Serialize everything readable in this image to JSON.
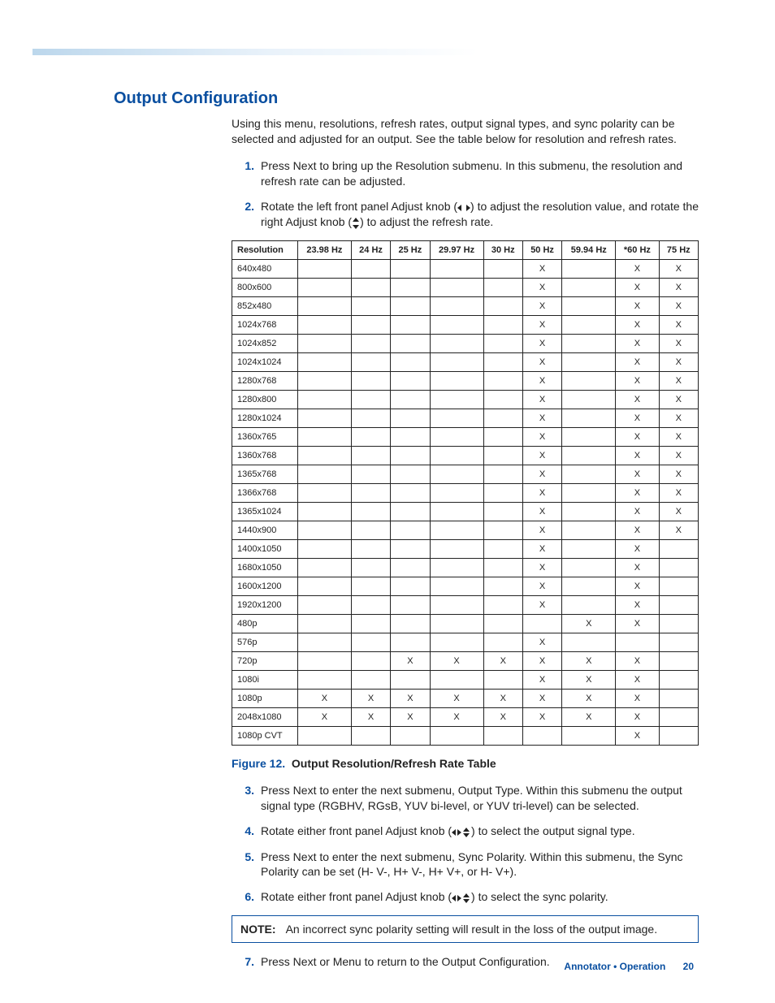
{
  "heading": "Output Configuration",
  "intro": "Using this menu, resolutions, refresh rates, output signal types, and sync polarity can be selected and adjusted for an output. See the table below for resolution and refresh rates.",
  "steps": [
    {
      "n": "1.",
      "text": "Press Next to bring up the Resolution submenu. In this submenu, the resolution and refresh rate can be adjusted."
    },
    {
      "n": "2.",
      "text_before": "Rotate the left front panel Adjust knob (",
      "text_mid": ") to adjust the resolution value, and rotate the right Adjust knob (",
      "text_after": ") to adjust the refresh rate.",
      "icon1": "lr",
      "icon2": "ud"
    },
    {
      "n": "3.",
      "text": "Press Next to enter the next submenu, Output Type. Within this submenu the output signal type (RGBHV, RGsB, YUV bi-level, or YUV tri-level) can be selected."
    },
    {
      "n": "4.",
      "text_before": "Rotate either front panel Adjust knob (",
      "text_after": ") to select the output signal type.",
      "icon1": "lrud"
    },
    {
      "n": "5.",
      "text": "Press Next to enter the next submenu, Sync Polarity. Within this submenu, the Sync Polarity can be set (H- V-, H+ V-, H+ V+, or H- V+)."
    },
    {
      "n": "6.",
      "text_before": "Rotate either front panel Adjust knob (",
      "text_after": ") to select the sync polarity.",
      "icon1": "lrud"
    },
    {
      "n": "7.",
      "text": "Press Next or Menu to return to the Output Configuration."
    }
  ],
  "note": {
    "label": "NOTE:",
    "body": "An incorrect sync polarity setting will result in the loss of the output image."
  },
  "figure": {
    "label": "Figure 12.",
    "title": "Output Resolution/Refresh Rate Table"
  },
  "table": {
    "headers": [
      "Resolution",
      "23.98 Hz",
      "24 Hz",
      "25 Hz",
      "29.97 Hz",
      "30 Hz",
      "50 Hz",
      "59.94 Hz",
      "*60 Hz",
      "75 Hz"
    ],
    "rows": [
      [
        "640x480",
        "",
        "",
        "",
        "",
        "",
        "X",
        "",
        "X",
        "X"
      ],
      [
        "800x600",
        "",
        "",
        "",
        "",
        "",
        "X",
        "",
        "X",
        "X"
      ],
      [
        "852x480",
        "",
        "",
        "",
        "",
        "",
        "X",
        "",
        "X",
        "X"
      ],
      [
        "1024x768",
        "",
        "",
        "",
        "",
        "",
        "X",
        "",
        "X",
        "X"
      ],
      [
        "1024x852",
        "",
        "",
        "",
        "",
        "",
        "X",
        "",
        "X",
        "X"
      ],
      [
        "1024x1024",
        "",
        "",
        "",
        "",
        "",
        "X",
        "",
        "X",
        "X"
      ],
      [
        "1280x768",
        "",
        "",
        "",
        "",
        "",
        "X",
        "",
        "X",
        "X"
      ],
      [
        "1280x800",
        "",
        "",
        "",
        "",
        "",
        "X",
        "",
        "X",
        "X"
      ],
      [
        "1280x1024",
        "",
        "",
        "",
        "",
        "",
        "X",
        "",
        "X",
        "X"
      ],
      [
        "1360x765",
        "",
        "",
        "",
        "",
        "",
        "X",
        "",
        "X",
        "X"
      ],
      [
        "1360x768",
        "",
        "",
        "",
        "",
        "",
        "X",
        "",
        "X",
        "X"
      ],
      [
        "1365x768",
        "",
        "",
        "",
        "",
        "",
        "X",
        "",
        "X",
        "X"
      ],
      [
        "1366x768",
        "",
        "",
        "",
        "",
        "",
        "X",
        "",
        "X",
        "X"
      ],
      [
        "1365x1024",
        "",
        "",
        "",
        "",
        "",
        "X",
        "",
        "X",
        "X"
      ],
      [
        "1440x900",
        "",
        "",
        "",
        "",
        "",
        "X",
        "",
        "X",
        "X"
      ],
      [
        "1400x1050",
        "",
        "",
        "",
        "",
        "",
        "X",
        "",
        "X",
        ""
      ],
      [
        "1680x1050",
        "",
        "",
        "",
        "",
        "",
        "X",
        "",
        "X",
        ""
      ],
      [
        "1600x1200",
        "",
        "",
        "",
        "",
        "",
        "X",
        "",
        "X",
        ""
      ],
      [
        "1920x1200",
        "",
        "",
        "",
        "",
        "",
        "X",
        "",
        "X",
        ""
      ],
      [
        "480p",
        "",
        "",
        "",
        "",
        "",
        "",
        "X",
        "X",
        ""
      ],
      [
        "576p",
        "",
        "",
        "",
        "",
        "",
        "X",
        "",
        "",
        ""
      ],
      [
        "720p",
        "",
        "",
        "X",
        "X",
        "X",
        "X",
        "X",
        "X",
        ""
      ],
      [
        "1080i",
        "",
        "",
        "",
        "",
        "",
        "X",
        "X",
        "X",
        ""
      ],
      [
        "1080p",
        "X",
        "X",
        "X",
        "X",
        "X",
        "X",
        "X",
        "X",
        ""
      ],
      [
        "2048x1080",
        "X",
        "X",
        "X",
        "X",
        "X",
        "X",
        "X",
        "X",
        ""
      ],
      [
        "1080p CVT",
        "",
        "",
        "",
        "",
        "",
        "",
        "",
        "X",
        ""
      ]
    ]
  },
  "footer": {
    "title": "Annotator • Operation",
    "page": "20"
  }
}
